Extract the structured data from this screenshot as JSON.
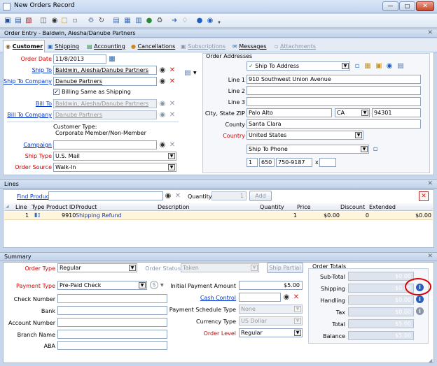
{
  "window": {
    "title": "New Orders Record"
  },
  "order_entry": {
    "header": "Order Entry - Baldwin, Aiesha/Danube Partners",
    "tabs": [
      "Customer",
      "Shipping",
      "Accounting",
      "Cancellations",
      "Subscriptions",
      "Messages",
      "Attachments"
    ],
    "order_date_label": "Order Date",
    "order_date": "11/8/2013",
    "ship_to_label": "Ship To",
    "ship_to": "Baldwin, Aiesha/Danube Partners",
    "ship_to_company_label": "Ship To Company",
    "ship_to_company": "Danube Partners",
    "billing_same_label": "Billing Same as Shipping",
    "bill_to_label": "Bill To",
    "bill_to": "Baldwin, Aiesha/Danube Partners",
    "bill_to_company_label": "Bill To Company",
    "bill_to_company": "Danube Partners",
    "customer_type_label": "Customer Type:",
    "customer_type": "Corporate Member/Non-Member",
    "campaign_label": "Campaign",
    "campaign": "",
    "ship_type_label": "Ship Type",
    "ship_type": "U.S. Mail",
    "order_source_label": "Order Source",
    "order_source": "Walk-In"
  },
  "addresses": {
    "header": "Order Addresses",
    "address_type": "Ship To Address",
    "line1_label": "Line 1",
    "line1": "910 Southwest Union Avenue",
    "line2_label": "Line 2",
    "line2": "",
    "line3_label": "Line 3",
    "line3": "",
    "city_label": "City, State ZIP",
    "city": "Palo Alto",
    "state": "CA",
    "zip": "94301",
    "county_label": "County",
    "county": "Santa Clara",
    "country_label": "Country",
    "country": "United States",
    "phone_type": "Ship To Phone",
    "phone_country": "1",
    "phone_area": "650",
    "phone_number": "750-9187",
    "phone_ext_label": "x",
    "phone_ext": ""
  },
  "lines": {
    "header": "Lines",
    "find_product_label": "Find Product",
    "find_product": "",
    "quantity_label": "Quantity",
    "quantity": "1",
    "add_label": "Add",
    "columns": [
      "Line",
      "Type",
      "Product ID",
      "Product",
      "Description",
      "Quantity",
      "Price",
      "Discount",
      "Extended"
    ],
    "rows": [
      {
        "line": "1",
        "product_id": "9910",
        "product": "Shipping Refund",
        "description": "",
        "quantity": "1",
        "price": "$0.00",
        "discount": "0",
        "extended": "$0.00"
      }
    ]
  },
  "summary": {
    "header": "Summary",
    "order_type_label": "Order Type",
    "order_type": "Regular",
    "order_status_label": "Order Status",
    "order_status": "Taken",
    "ship_partial_label": "Ship Partial",
    "payment_type_label": "Payment Type",
    "payment_type": "Pre-Paid Check",
    "check_number_label": "Check Number",
    "bank_label": "Bank",
    "account_number_label": "Account Number",
    "branch_name_label": "Branch Name",
    "aba_label": "ABA",
    "initial_payment_label": "Initial Payment Amount",
    "initial_payment": "$5.00",
    "cash_control_label": "Cash Control",
    "payment_schedule_label": "Payment Schedule Type",
    "payment_schedule": "None",
    "currency_type_label": "Currency Type",
    "currency_type": "US Dollar",
    "order_level_label": "Order Level",
    "order_level": "Regular",
    "totals_header": "Order Totals",
    "totals": [
      {
        "label": "Sub-Total",
        "value": "$0.00"
      },
      {
        "label": "Shipping",
        "value": "$0.00"
      },
      {
        "label": "Handling",
        "value": "$0.00"
      },
      {
        "label": "Tax",
        "value": "$0.00"
      },
      {
        "label": "Total",
        "value": "$5.00"
      },
      {
        "label": "Balance",
        "value": "$5.00"
      }
    ]
  },
  "colors": {
    "accent": "#0033cc",
    "required": "#cc0000",
    "annotation": "#dd0000"
  }
}
